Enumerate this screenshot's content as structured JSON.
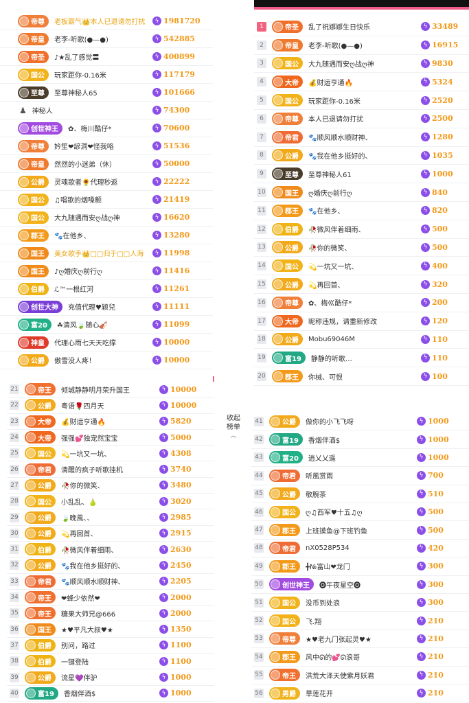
{
  "colors": {
    "accent": "#f0627d",
    "points": "#f29a1c",
    "bolt": "#8b4ee8",
    "badges": {
      "帝尊": "#f07f3a",
      "帝皇": "#ef7a2e",
      "帝圣": "#f06f2a",
      "国公": "#f2b21a",
      "至尊": "#4a3c2a",
      "创世神王": "#a24be0",
      "公爵": "#f2a91a",
      "郡王": "#f39a1a",
      "国王": "#f08a1a",
      "伯爵": "#efb315",
      "富20": "#22b088",
      "富19": "#22a884",
      "神皇": "#e03a2a",
      "大帝": "#f0681f",
      "帝君": "#ef6d35",
      "帝王": "#f07030",
      "男爵": "#f0b41c",
      "创世大神": "#7a3ed8"
    }
  },
  "icons": {
    "bolt": "lightning-icon",
    "crown": "crown-icon",
    "chevron": "chevron-up-icon"
  },
  "collapse": {
    "line1": "收起",
    "line2": "榜单",
    "chevron": "︿"
  },
  "left_top": [
    {
      "badge": "帝尊",
      "name": "老板霸气👑本人已退请勿打扰",
      "gold": true,
      "value": "1981720"
    },
    {
      "badge": "帝皇",
      "name": "老李-听歌(●—●)",
      "value": "542885"
    },
    {
      "badge": "帝圣",
      "name": "♪★乱了感觉〓",
      "value": "400899"
    },
    {
      "badge": "国公",
      "name": "玩家距你-0.16米",
      "value": "117179"
    },
    {
      "badge": "至尊",
      "name": "至尊神秘人65",
      "value": "101666"
    },
    {
      "badge": "",
      "name": "神秘人",
      "value": "74300"
    },
    {
      "badge": "创世神王",
      "name": "✿、梅川酷仔*",
      "value": "70600"
    },
    {
      "badge": "帝尊",
      "name": "妗笙❤諺洞❤怪我咯",
      "value": "51536"
    },
    {
      "badge": "帝皇",
      "name": "然然的小迷弟（休）",
      "value": "50000"
    },
    {
      "badge": "公爵",
      "name": "灵魂歌者🌻代理秒返",
      "value": "22222"
    },
    {
      "badge": "国公",
      "name": "♫唱歌的烟嗓颤",
      "value": "21419"
    },
    {
      "badge": "国公",
      "name": "大九随遇而安ღ战ღ神",
      "value": "16620"
    },
    {
      "badge": "郡王",
      "name": "🐾在他乡、",
      "value": "13280"
    },
    {
      "badge": "国王",
      "name": "美女歌手👑□□归于□□人海",
      "gold": true,
      "value": "11998"
    },
    {
      "badge": "国王",
      "name": "♪ღ婚庆ღ前行ღ",
      "value": "11416"
    },
    {
      "badge": "伯爵",
      "name": "ℒ™一根红河",
      "value": "11261"
    },
    {
      "badge": "创世大神",
      "name": "充值代理♥颖兒",
      "value": "11111"
    },
    {
      "badge": "富20",
      "name": "☘清风🍃随心🎻",
      "value": "11099"
    },
    {
      "badge": "神皇",
      "name": "代理心雨七天天吃撑",
      "value": "10000"
    },
    {
      "badge": "公爵",
      "name": "傲雪没人疼！",
      "value": "10000"
    }
  ],
  "left_bottom": [
    {
      "rank": "21",
      "badge": "帝王",
      "name": "倾城静静明月荣升国王",
      "value": "10000"
    },
    {
      "rank": "22",
      "badge": "公爵",
      "name": "粤语🌹四月天",
      "value": "10000"
    },
    {
      "rank": "23",
      "badge": "大帝",
      "name": "💰财运亨通🔥",
      "value": "5820"
    },
    {
      "rank": "24",
      "badge": "大帝",
      "name": "强强💕独宠然宝宝",
      "value": "5000"
    },
    {
      "rank": "25",
      "badge": "国公",
      "name": "💫一坑又一坑、",
      "value": "4308"
    },
    {
      "rank": "26",
      "badge": "帝君",
      "name": "清醒的疯子听歌挂机",
      "value": "3740"
    },
    {
      "rank": "27",
      "badge": "公爵",
      "name": "🥀你的微笑、",
      "value": "3480"
    },
    {
      "rank": "28",
      "badge": "国公",
      "name": "小乱乱、🍐",
      "value": "3020"
    },
    {
      "rank": "29",
      "badge": "公爵",
      "name": "🍃晚風、、",
      "value": "2985"
    },
    {
      "rank": "30",
      "badge": "公爵",
      "name": "💫再回首、",
      "value": "2915"
    },
    {
      "rank": "31",
      "badge": "伯爵",
      "name": "🥀微风伴着细雨、",
      "value": "2630"
    },
    {
      "rank": "32",
      "badge": "公爵",
      "name": "🐾我在他乡挺好的、",
      "value": "2450"
    },
    {
      "rank": "33",
      "badge": "帝君",
      "name": "🐾顺风顺水顺财神、",
      "value": "2205"
    },
    {
      "rank": "34",
      "badge": "帝王",
      "name": "❤蜂少依然❤",
      "value": "2000"
    },
    {
      "rank": "35",
      "badge": "帝王",
      "name": "糖果大师兄@666",
      "value": "2000"
    },
    {
      "rank": "36",
      "badge": "国王",
      "name": "★♥平凡大叔♥★",
      "value": "1350"
    },
    {
      "rank": "37",
      "badge": "伯爵",
      "name": "别问，路过",
      "value": "1100"
    },
    {
      "rank": "38",
      "badge": "伯爵",
      "name": "一键登陆",
      "value": "1100"
    },
    {
      "rank": "39",
      "badge": "公爵",
      "name": "流星💜伴驴",
      "value": "1000"
    },
    {
      "rank": "40",
      "badge": "富19",
      "name": "香烟伴酒$",
      "value": "1000"
    }
  ],
  "right_top": [
    {
      "rank": "1",
      "badge": "帝圣",
      "name": "乱了祝娜娜生日快乐",
      "value": "33489"
    },
    {
      "rank": "2",
      "badge": "帝皇",
      "name": "老李-听歌(●—●)",
      "value": "16915"
    },
    {
      "rank": "3",
      "badge": "国公",
      "name": "大九随遇而安ღ战ღ神",
      "value": "9830"
    },
    {
      "rank": "4",
      "badge": "大帝",
      "name": "💰财运亨通🔥",
      "value": "5324"
    },
    {
      "rank": "5",
      "badge": "国公",
      "name": "玩家距你-0.16米",
      "value": "2520"
    },
    {
      "rank": "6",
      "badge": "帝尊",
      "name": "本人已退请勿打扰",
      "value": "2500"
    },
    {
      "rank": "7",
      "badge": "帝君",
      "name": "🐾顺风顺水顺财神、",
      "value": "1280"
    },
    {
      "rank": "8",
      "badge": "公爵",
      "name": "🐾我在他乡挺好的、",
      "value": "1035"
    },
    {
      "rank": "9",
      "badge": "至尊",
      "name": "至尊神秘人61",
      "value": "1000"
    },
    {
      "rank": "10",
      "badge": "国王",
      "name": "ღ婚庆ღ前行ღ",
      "value": "840"
    },
    {
      "rank": "11",
      "badge": "郡王",
      "name": "🐾在他乡、",
      "value": "820"
    },
    {
      "rank": "12",
      "badge": "伯爵",
      "name": "🥀微风伴着细雨、",
      "value": "500"
    },
    {
      "rank": "13",
      "badge": "公爵",
      "name": "🥀你的微笑、",
      "value": "500"
    },
    {
      "rank": "14",
      "badge": "国公",
      "name": "💫一坑又一坑、",
      "value": "400"
    },
    {
      "rank": "15",
      "badge": "公爵",
      "name": "💫再回首、",
      "value": "320"
    },
    {
      "rank": "16",
      "badge": "帝尊",
      "name": "✿、梅巛酷仔*",
      "value": "200"
    },
    {
      "rank": "17",
      "badge": "大帝",
      "name": "昵称违规，请重新修改",
      "value": "120"
    },
    {
      "rank": "18",
      "badge": "公爵",
      "name": "Mobu69046M",
      "value": "110"
    },
    {
      "rank": "19",
      "badge": "富19",
      "name": "静静的听歌…",
      "value": "110"
    },
    {
      "rank": "20",
      "badge": "郡王",
      "name": "你械、可恨",
      "value": "100"
    }
  ],
  "right_bottom": [
    {
      "rank": "41",
      "badge": "公爵",
      "name": "做你的小飞飞呀",
      "value": "1000"
    },
    {
      "rank": "42",
      "badge": "富19",
      "name": "香烟伴酒$",
      "value": "1000"
    },
    {
      "rank": "43",
      "badge": "富20",
      "name": "逍乂乂遥",
      "value": "1000"
    },
    {
      "rank": "44",
      "badge": "帝君",
      "name": "听風赏雨",
      "value": "700"
    },
    {
      "rank": "45",
      "badge": "公爵",
      "name": "敬腕茶",
      "value": "510"
    },
    {
      "rank": "46",
      "badge": "国公",
      "name": "ღ♫西军♥十五♫ღ",
      "value": "500"
    },
    {
      "rank": "47",
      "badge": "郡王",
      "name": "上班摸鱼@下班钓鱼",
      "value": "500"
    },
    {
      "rank": "48",
      "badge": "帝君",
      "name": "nX0528P534",
      "value": "420"
    },
    {
      "rank": "49",
      "badge": "郡王",
      "name": "╋№富山❤龙门",
      "value": "300"
    },
    {
      "rank": "50",
      "badge": "创世神王",
      "name": "🅞午夜星空🅞",
      "value": "300"
    },
    {
      "rank": "51",
      "badge": "国公",
      "name": "没币到处浪",
      "value": "300"
    },
    {
      "rank": "52",
      "badge": "国公",
      "name": "飞.翔",
      "value": "210"
    },
    {
      "rank": "53",
      "badge": "帝尊",
      "name": "★♥老九门张起灵♥★",
      "value": "210"
    },
    {
      "rank": "54",
      "badge": "郡王",
      "name": "风中ᘏ的💕ᘏ浪哥",
      "value": "210"
    },
    {
      "rank": "55",
      "badge": "帝王",
      "name": "洪荒大泽天使紫月妖君",
      "value": "210"
    },
    {
      "rank": "56",
      "badge": "男爵",
      "name": "旱莲花开",
      "value": "210"
    }
  ]
}
